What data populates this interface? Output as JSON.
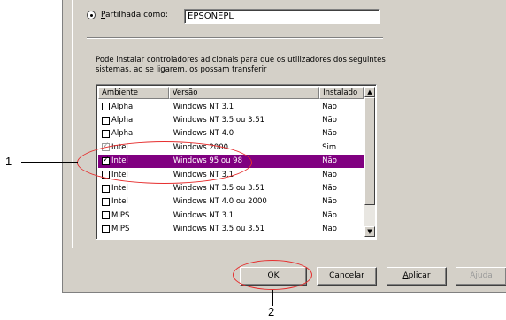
{
  "share": {
    "radio_label_prefix": "P",
    "radio_label_rest": "artilhada como:",
    "share_name": "EPSONEPL"
  },
  "info_text": "Pode instalar controladores adicionais para que os utilizadores dos seguintes sistemas, ao se ligarem, os possam transferir",
  "table": {
    "headers": [
      "Ambiente",
      "Versão",
      "Instalado"
    ],
    "rows": [
      {
        "env": "Alpha",
        "version": "Windows NT 3.1",
        "installed": "Não",
        "checked": false
      },
      {
        "env": "Alpha",
        "version": "Windows NT 3.5 ou 3.51",
        "installed": "Não",
        "checked": false
      },
      {
        "env": "Alpha",
        "version": "Windows NT 4.0",
        "installed": "Não",
        "checked": false
      },
      {
        "env": "Intel",
        "version": "Windows 2000",
        "installed": "Sim",
        "checked": true,
        "disabled": true
      },
      {
        "env": "Intel",
        "version": "Windows 95 ou 98",
        "installed": "Não",
        "checked": true,
        "selected": true
      },
      {
        "env": "Intel",
        "version": "Windows NT 3.1",
        "installed": "Não",
        "checked": false
      },
      {
        "env": "Intel",
        "version": "Windows NT 3.5 ou 3.51",
        "installed": "Não",
        "checked": false
      },
      {
        "env": "Intel",
        "version": "Windows NT 4.0 ou 2000",
        "installed": "Não",
        "checked": false
      },
      {
        "env": "MIPS",
        "version": "Windows NT 3.1",
        "installed": "Não",
        "checked": false
      },
      {
        "env": "MIPS",
        "version": "Windows NT 3.5 ou 3.51",
        "installed": "Não",
        "checked": false
      }
    ]
  },
  "buttons": {
    "ok": "OK",
    "cancel": "Cancelar",
    "apply_prefix": "A",
    "apply_rest": "plicar",
    "help": "Ajuda"
  },
  "callouts": {
    "one": "1",
    "two": "2"
  },
  "colors": {
    "selection": "#800080",
    "callout": "#e62e2e",
    "dialog_bg": "#d4d0c8"
  }
}
